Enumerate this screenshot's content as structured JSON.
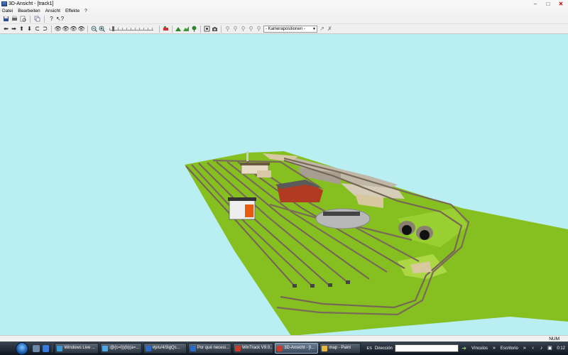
{
  "window": {
    "title": "3D-Ansicht - [track1]"
  },
  "menu": {
    "items": [
      "Datei",
      "Bearbeiten",
      "Ansicht",
      "Effekte",
      "?"
    ]
  },
  "toolbar2": {
    "camera_select_value": "- Kamerapositionen -"
  },
  "viewport": {
    "sky_color": "#b9eef3",
    "ground_color": "#86c020",
    "track_color": "#7a6a58"
  },
  "statusbar": {
    "num_indicator": "NUM"
  },
  "taskbar": {
    "tasks": [
      {
        "label": "Windows Live ...",
        "active": false
      },
      {
        "label": ":@(c=l))(b)(a=...",
        "active": false
      },
      {
        "label": "#p/u/4/3igQc...",
        "active": false
      },
      {
        "label": "Por qué necesi...",
        "active": false
      },
      {
        "label": "WinTrack V9.0...",
        "active": false
      },
      {
        "label": "3D-Ansicht - [t...",
        "active": true
      },
      {
        "label": "map - Paint",
        "active": false
      }
    ],
    "language": "ES",
    "address_label": "Dirección",
    "links_label": "Vínculos",
    "desktop_label": "Escritorio",
    "clock": "0:12"
  }
}
